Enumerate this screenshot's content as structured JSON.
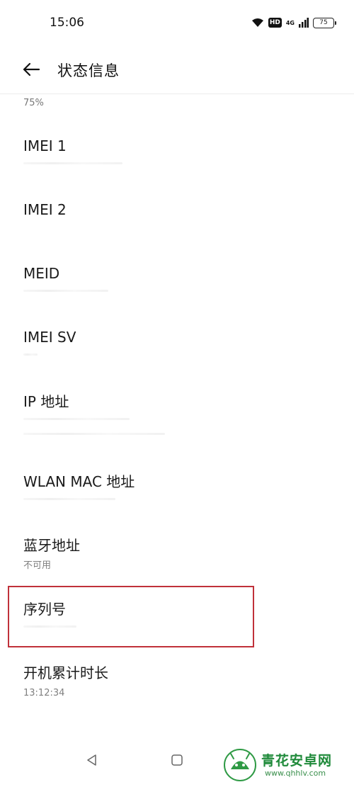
{
  "status_bar": {
    "time": "15:06",
    "hd_label": "HD",
    "network_label": "4G",
    "battery_level": "75"
  },
  "header": {
    "title": "状态信息"
  },
  "top_partial_value": "75%",
  "items": [
    {
      "title": "IMEI 1",
      "subtitle": ""
    },
    {
      "title": "IMEI 2",
      "subtitle": ""
    },
    {
      "title": "MEID",
      "subtitle": ""
    },
    {
      "title": "IMEI SV",
      "subtitle": ""
    },
    {
      "title": "IP 地址",
      "subtitle": ""
    },
    {
      "title": "WLAN MAC 地址",
      "subtitle": ""
    },
    {
      "title": "蓝牙地址",
      "subtitle": "不可用"
    },
    {
      "title": "序列号",
      "subtitle": ""
    },
    {
      "title": "开机累计时长",
      "subtitle": "13:12:34"
    }
  ],
  "watermark": {
    "text": "青花安卓网",
    "url": "www.qhhlv.com"
  },
  "colors": {
    "highlight": "#c0313a",
    "watermark": "#1f8a3a"
  }
}
